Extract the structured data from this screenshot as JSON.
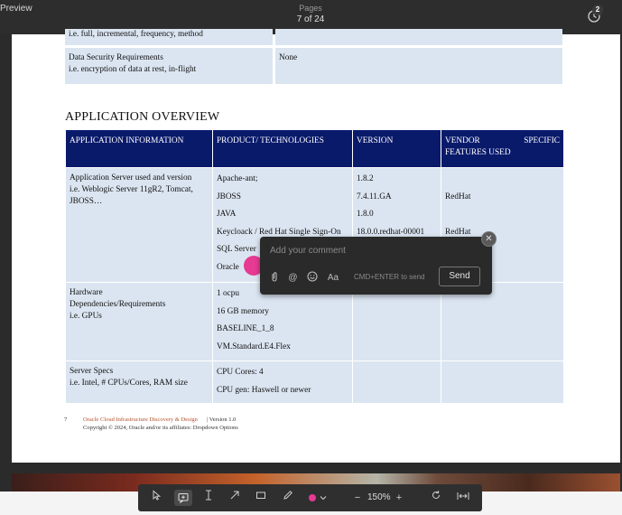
{
  "app": {
    "title": "Preview"
  },
  "header": {
    "pages_label": "Pages",
    "page_indicator": "7 of 24",
    "history_count": "2"
  },
  "doc": {
    "top_table": {
      "row_clipped_label": "i.e. full, incremental, frequency, method",
      "security_label_1": "Data Security Requirements",
      "security_label_2": "i.e. encryption of data at rest, in-flight",
      "security_value": "None"
    },
    "section_title": "APPLICATION OVERVIEW",
    "headers": [
      "APPLICATION INFORMATION",
      "PRODUCT/ TECHNOLOGIES",
      "VERSION",
      "VENDOR SPECIFIC FEATURES USED"
    ],
    "header_vendor_1": "VENDOR",
    "header_vendor_2": "SPECIFIC",
    "header_vendor_3": "FEATURES USED",
    "row1": {
      "label_1": "Application Server used and version",
      "label_2": "i.e. Weblogic Server 11gR2, Tomcat,",
      "label_3": "JBOSS…",
      "products": [
        "Apache-ant;",
        "JBOSS",
        "JAVA",
        "Keycloack / Red Hat Single Sign-On",
        "SQL Server",
        "Oracle"
      ],
      "versions": [
        "1.8.2",
        "7.4.11.GA",
        "1.8.0",
        "18.0.0.redhat-00001"
      ],
      "vendors": [
        "RedHat",
        "RedHat"
      ]
    },
    "row2": {
      "label_1": "Hardware",
      "label_2": "Dependencies/Requirements",
      "label_3": "i.e. GPUs",
      "products": [
        "1 ocpu",
        "16 GB memory",
        "BASELINE_1_8",
        "VM.Standard.E4.Flex"
      ]
    },
    "row3": {
      "label_1": "Server Specs",
      "label_2": "i.e. Intel, # CPUs/Cores, RAM size",
      "products": [
        "CPU Cores: 4",
        "CPU gen: Haswell or newer"
      ]
    },
    "footer": {
      "page_number": "7",
      "doc_title": "Oracle Cloud Infrastructure Discovery & Design",
      "version": "| Version 1.0",
      "copyright": "Copyright © 2024, Oracle and/or its affiliates:   Dropdown Options"
    }
  },
  "comment": {
    "placeholder": "Add your comment",
    "hint": "CMD+ENTER to send",
    "send_label": "Send",
    "format_label": "Aa",
    "pin_color": "#e63a93"
  },
  "toolbar": {
    "zoom": "150%",
    "markup_color": "#e63a93"
  }
}
